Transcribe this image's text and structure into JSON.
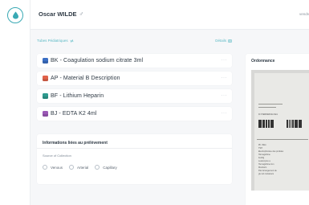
{
  "patient": {
    "name": "Oscar WILDE",
    "sex_symbol": "♂"
  },
  "topbar": {
    "right_text": "vendredi"
  },
  "tubes_section": {
    "title": "Tubes Pédiatriques",
    "details_label": "Détails"
  },
  "tubes": [
    {
      "label": "BK - Coagulation sodium citrate 3ml",
      "color": "#3b6fc4"
    },
    {
      "label": "AP - Material B Description",
      "color": "#e0624a"
    },
    {
      "label": "BF - Lithium Heparin",
      "color": "#2e9a8e"
    },
    {
      "label": "BJ - EDTA K2 4ml",
      "color": "#9b59b6"
    }
  ],
  "collection_info": {
    "title": "Informations liées au prélèvement",
    "source_label": "Source of Collection",
    "options": [
      "Venous",
      "Arterial",
      "Capillary"
    ]
  },
  "ordonnance": {
    "title": "Ordonnance",
    "doc_lines": [
      "Dr PIERRERUE Marc",
      "Ph. ffdkn",
      "TSH",
      "Electrophorèse des protides",
      "Hémoglobine",
      "Fe/Mg",
      "Leukocytes a",
      "Hemoglobine  Gm",
      "Monitorin",
      "Pas Arrangement de",
      "glu ref containers"
    ]
  },
  "colors": {
    "accent": "#3aa9b4",
    "background": "#f6f7f9"
  }
}
